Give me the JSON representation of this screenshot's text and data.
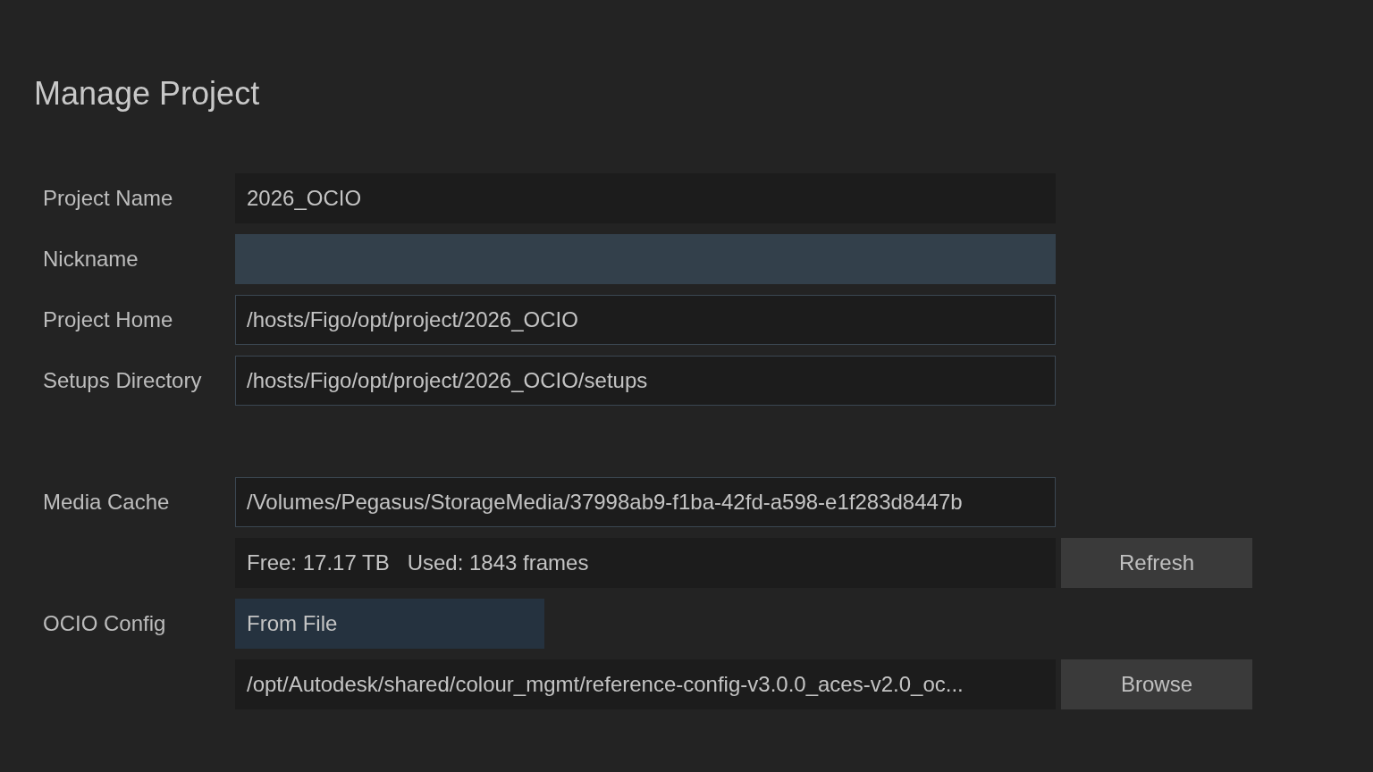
{
  "title": "Manage Project",
  "sections": [
    {
      "rows": [
        {
          "label": "Project Name",
          "field": {
            "kind": "readonly",
            "value": "2026_OCIO"
          }
        },
        {
          "label": "Nickname",
          "field": {
            "kind": "focused"
          }
        },
        {
          "label": "Project Home",
          "field": {
            "kind": "editable",
            "value": "/hosts/Figo/opt/project/2026_OCIO"
          }
        },
        {
          "label": "Setups Directory",
          "field": {
            "kind": "editable",
            "value": "/hosts/Figo/opt/project/2026_OCIO/setups"
          }
        }
      ]
    },
    {
      "rows": [
        {
          "label": "Media Cache",
          "field": {
            "kind": "editable",
            "value": "/Volumes/Pegasus/StorageMedia/37998ab9-f1ba-42fd-a598-e1f283d8447b"
          }
        },
        {
          "field": {
            "kind": "info",
            "value": "Free: 17.17 TB   Used: 1843 frames"
          },
          "button": "Refresh"
        },
        {
          "label": "OCIO Config",
          "field": {
            "kind": "dropdown",
            "value": "From File"
          }
        },
        {
          "field": {
            "kind": "readonly",
            "value": "/opt/Autodesk/shared/colour_mgmt/reference-config-v3.0.0_aces-v2.0_oc..."
          },
          "button": "Browse"
        }
      ]
    }
  ]
}
